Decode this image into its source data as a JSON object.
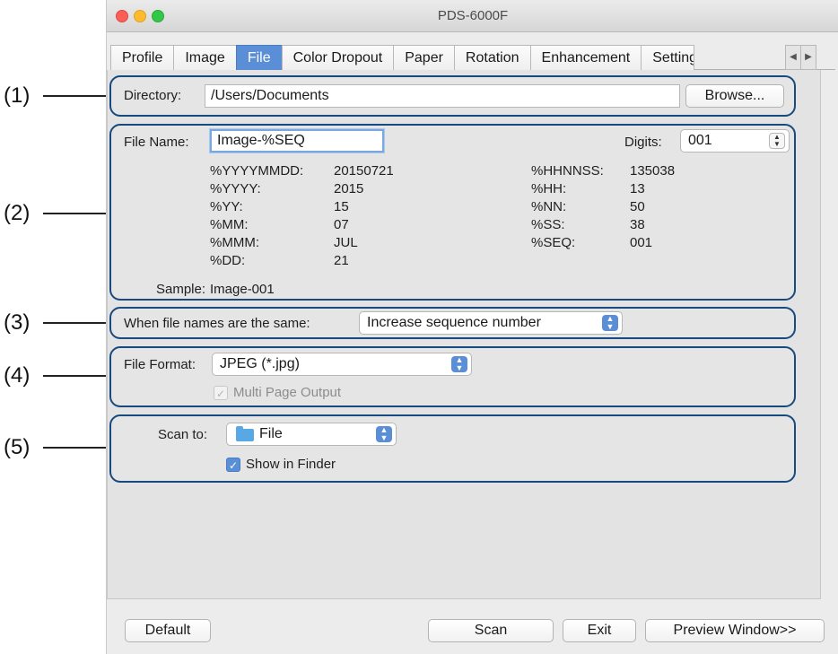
{
  "callouts": [
    "(1)",
    "(2)",
    "(3)",
    "(4)",
    "(5)"
  ],
  "window": {
    "title": "PDS-6000F"
  },
  "tabs": [
    {
      "label": "Profile"
    },
    {
      "label": "Image"
    },
    {
      "label": "File",
      "active": true
    },
    {
      "label": "Color Dropout"
    },
    {
      "label": "Paper"
    },
    {
      "label": "Rotation"
    },
    {
      "label": "Enhancement"
    },
    {
      "label": "Setting"
    }
  ],
  "tab_scroll": {
    "left": "◀",
    "right": "▶"
  },
  "directory": {
    "label": "Directory:",
    "value": "/Users/Documents",
    "browse_label": "Browse..."
  },
  "filename": {
    "label": "File Name:",
    "value": "Image-%SEQ",
    "digits_label": "Digits:",
    "digits_value": "001",
    "variables_left": [
      {
        "key": "%YYYYMMDD:",
        "value": "20150721"
      },
      {
        "key": "%YYYY:",
        "value": "2015"
      },
      {
        "key": "%YY:",
        "value": "15"
      },
      {
        "key": "%MM:",
        "value": "07"
      },
      {
        "key": "%MMM:",
        "value": "JUL"
      },
      {
        "key": "%DD:",
        "value": "21"
      }
    ],
    "variables_right": [
      {
        "key": "%HHNNSS:",
        "value": "135038"
      },
      {
        "key": "%HH:",
        "value": "13"
      },
      {
        "key": "%NN:",
        "value": "50"
      },
      {
        "key": "%SS:",
        "value": "38"
      },
      {
        "key": "%SEQ:",
        "value": "001"
      }
    ],
    "sample_label": "Sample:",
    "sample_value": "Image-001"
  },
  "same_names": {
    "label": "When file names are the same:",
    "value": "Increase sequence number"
  },
  "format": {
    "label": "File Format:",
    "value": "JPEG (*.jpg)",
    "multipage_label": "Multi Page Output",
    "multipage_checked": true,
    "multipage_enabled": false
  },
  "scan_to": {
    "label": "Scan to:",
    "value": "File",
    "icon": "folder-icon",
    "show_finder_label": "Show in Finder",
    "show_finder_checked": true
  },
  "footer": {
    "default_label": "Default",
    "scan_label": "Scan",
    "exit_label": "Exit",
    "preview_label": "Preview Window>>"
  },
  "colors": {
    "accent": "#5a8fd8",
    "group_border": "#174a7e"
  }
}
